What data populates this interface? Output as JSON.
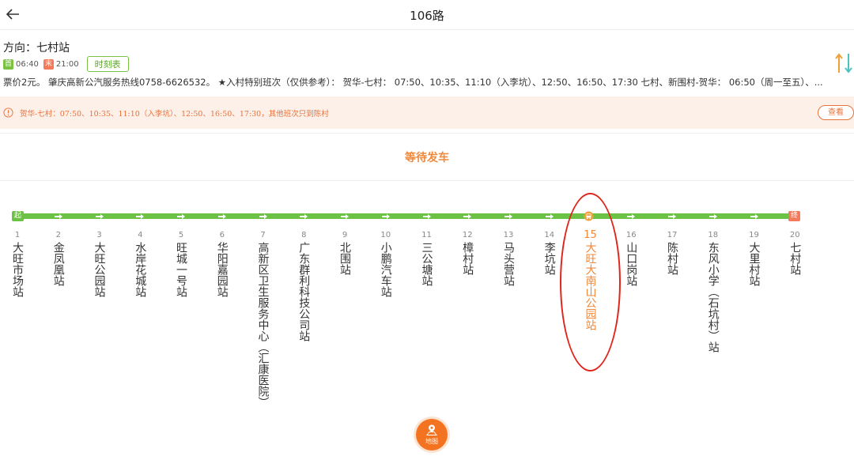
{
  "header": {
    "title": "106路",
    "back_icon": "arrow-left-icon"
  },
  "info": {
    "direction_label": "方向：七村站",
    "first_tag": "首",
    "first_time": "06:40",
    "last_tag": "末",
    "last_time": "21:00",
    "timetable_label": "时刻表",
    "notice": "票价2元。 肇庆高新公汽服务热线0758-6626532。 ★入村特别班次（仅供参考）： 贺华-七村： 07:50、10:35、11:10（入李坑）、12:50、16:50、17:30 七村、新围村-贺华： 06:50（周一至五）、..."
  },
  "alert": {
    "text": "贺华-七村：07:50、10:35、11:10（入李坑）、12:50、16:50、17:30，其他班次只到陈村",
    "button_label": "查看"
  },
  "status": "等待发车",
  "route": {
    "start_tag": "起",
    "end_tag": "终",
    "current_stop_index": 15,
    "stops": [
      {
        "num": "1",
        "name": "大旺市场站"
      },
      {
        "num": "2",
        "name": "金凤凰站"
      },
      {
        "num": "3",
        "name": "大旺公园站"
      },
      {
        "num": "4",
        "name": "水岸花城站"
      },
      {
        "num": "5",
        "name": "旺城一号站"
      },
      {
        "num": "6",
        "name": "华阳嘉园站"
      },
      {
        "num": "7",
        "name": "高新区卫生服务中心︵汇康医院︶"
      },
      {
        "num": "8",
        "name": "广东群利科技公司站"
      },
      {
        "num": "9",
        "name": "北围站"
      },
      {
        "num": "10",
        "name": "小鹏汽车站"
      },
      {
        "num": "11",
        "name": "三公塘站"
      },
      {
        "num": "12",
        "name": "樟村站"
      },
      {
        "num": "13",
        "name": "马头营站"
      },
      {
        "num": "14",
        "name": "李坑站"
      },
      {
        "num": "15",
        "name": "大旺大南山公园站"
      },
      {
        "num": "16",
        "name": "山口岗站"
      },
      {
        "num": "17",
        "name": "陈村站"
      },
      {
        "num": "18",
        "name": "东风小学︵石坑村︶站"
      },
      {
        "num": "19",
        "name": "大里村站"
      },
      {
        "num": "20",
        "name": "七村站"
      }
    ]
  },
  "map_button": {
    "label": "地图",
    "icon": "map-pin-icon"
  },
  "colors": {
    "accent_orange": "#f0883a",
    "track_green": "#6cc244",
    "highlight_red": "#e0251b"
  }
}
